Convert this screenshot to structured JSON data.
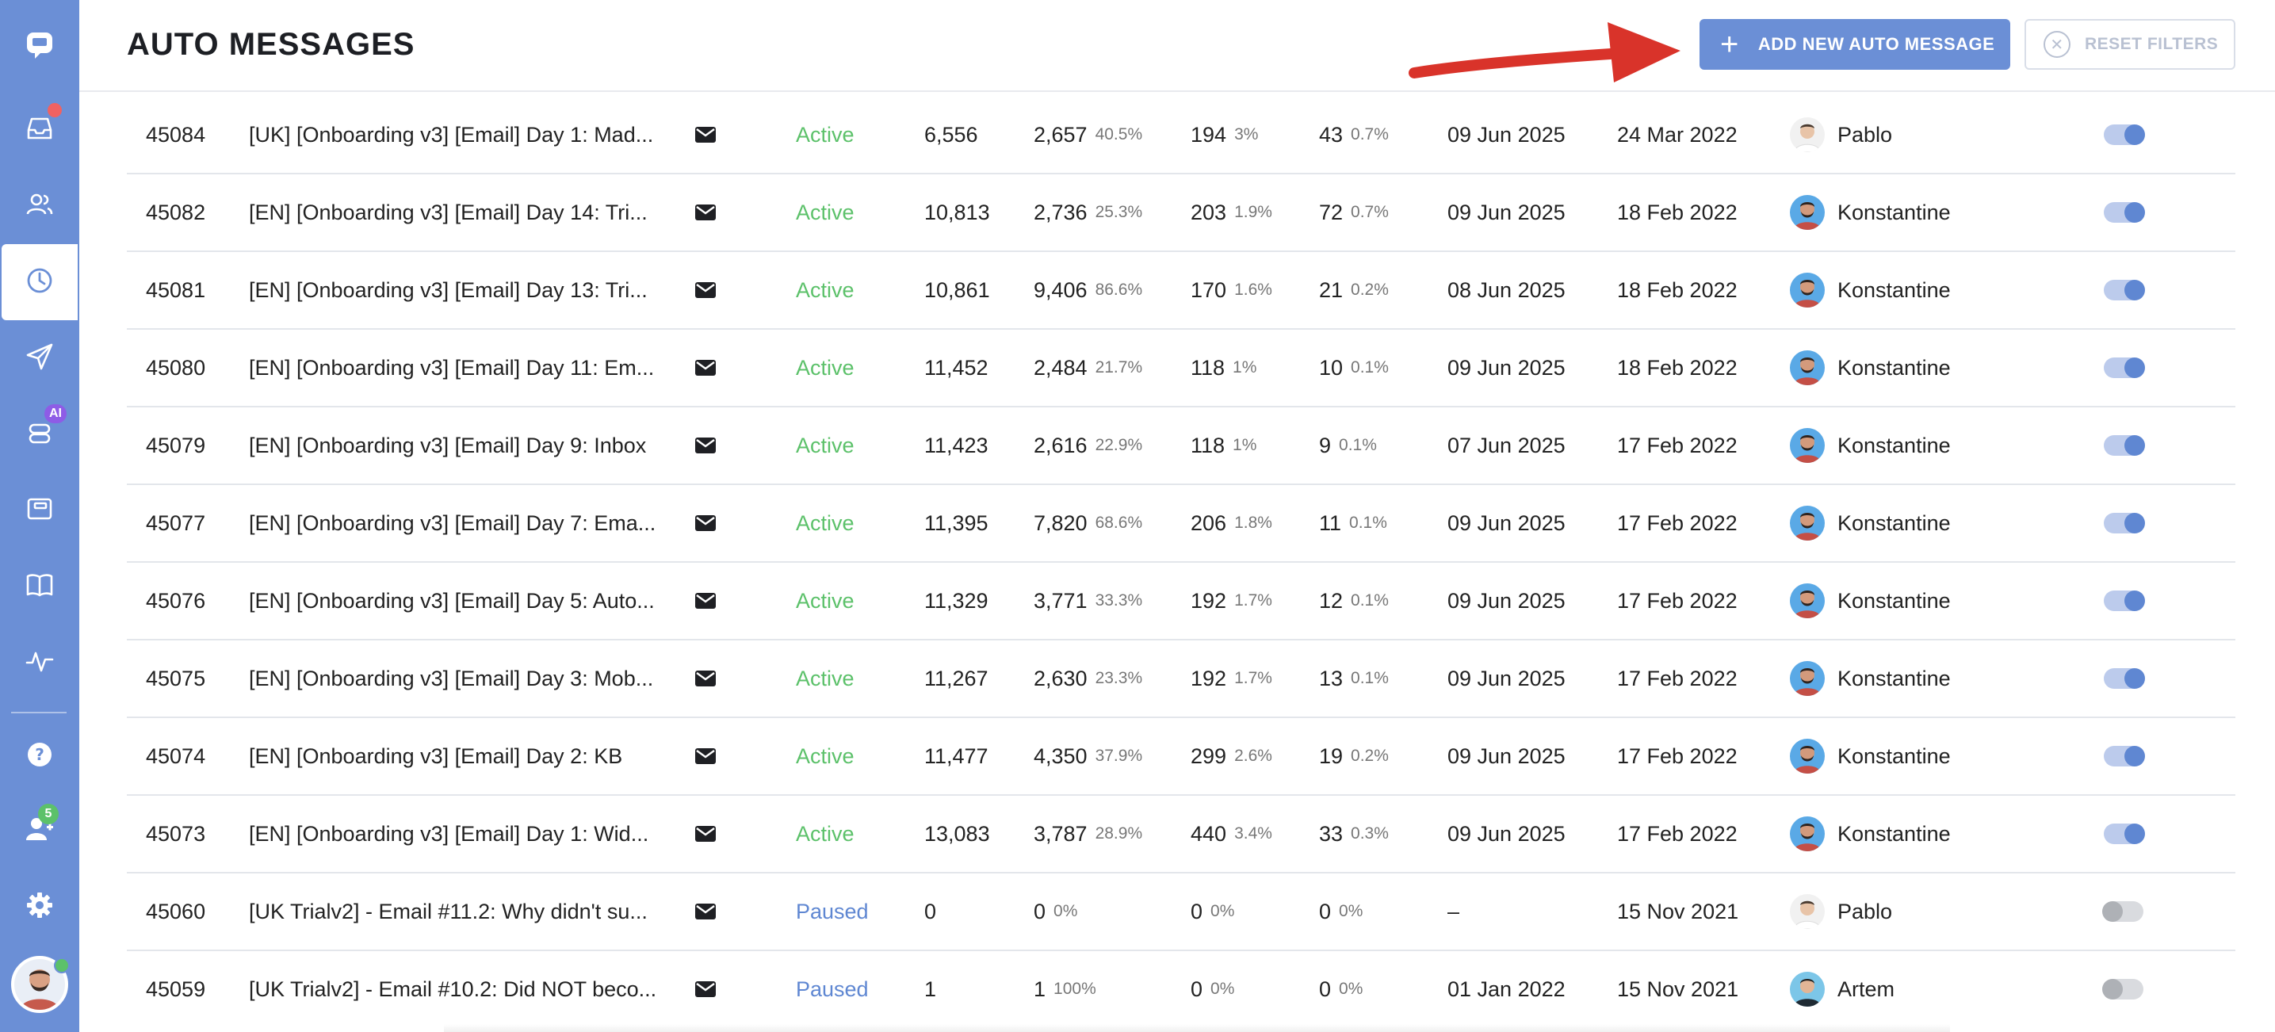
{
  "header": {
    "title": "AUTO MESSAGES",
    "add_button": "ADD NEW AUTO MESSAGE",
    "reset_button": "RESET FILTERS"
  },
  "sidebar": {
    "ai_badge": "AI",
    "leads_badge": "5",
    "items": [
      {
        "icon": "chat-logo-icon"
      },
      {
        "icon": "inbox-icon",
        "has_dot": true
      },
      {
        "icon": "users-icon"
      },
      {
        "icon": "clock-icon",
        "active": true
      },
      {
        "icon": "send-icon"
      },
      {
        "icon": "ai-bot-icon"
      },
      {
        "icon": "wallet-icon"
      },
      {
        "icon": "book-icon"
      },
      {
        "icon": "activity-icon"
      },
      {
        "icon": "help-icon"
      },
      {
        "icon": "leads-icon"
      },
      {
        "icon": "gear-icon"
      }
    ]
  },
  "colors": {
    "sidebar": "#6b8fd6",
    "primary": "#6b8fd6",
    "active_status": "#5cc16a",
    "paused_status": "#5f87d2",
    "annotation_arrow": "#d9332a"
  },
  "rows": [
    {
      "id": "45084",
      "name": "[UK] [Onboarding v3] [Email] Day 1: Mad...",
      "status": "Active",
      "sent": "6,556",
      "opened": "2,657",
      "opened_pct": "40.5%",
      "clicked": "194",
      "clicked_pct": "3%",
      "conv": "43",
      "conv_pct": "0.7%",
      "last": "09 Jun 2025",
      "created": "24 Mar 2022",
      "author": "Pablo",
      "avatar": "pablo",
      "enabled": true
    },
    {
      "id": "45082",
      "name": "[EN] [Onboarding v3] [Email] Day 14: Tri...",
      "status": "Active",
      "sent": "10,813",
      "opened": "2,736",
      "opened_pct": "25.3%",
      "clicked": "203",
      "clicked_pct": "1.9%",
      "conv": "72",
      "conv_pct": "0.7%",
      "last": "09 Jun 2025",
      "created": "18 Feb 2022",
      "author": "Konstantine",
      "avatar": "konst",
      "enabled": true
    },
    {
      "id": "45081",
      "name": "[EN] [Onboarding v3] [Email] Day 13: Tri...",
      "status": "Active",
      "sent": "10,861",
      "opened": "9,406",
      "opened_pct": "86.6%",
      "clicked": "170",
      "clicked_pct": "1.6%",
      "conv": "21",
      "conv_pct": "0.2%",
      "last": "08 Jun 2025",
      "created": "18 Feb 2022",
      "author": "Konstantine",
      "avatar": "konst",
      "enabled": true
    },
    {
      "id": "45080",
      "name": "[EN] [Onboarding v3] [Email] Day 11: Em...",
      "status": "Active",
      "sent": "11,452",
      "opened": "2,484",
      "opened_pct": "21.7%",
      "clicked": "118",
      "clicked_pct": "1%",
      "conv": "10",
      "conv_pct": "0.1%",
      "last": "09 Jun 2025",
      "created": "18 Feb 2022",
      "author": "Konstantine",
      "avatar": "konst",
      "enabled": true
    },
    {
      "id": "45079",
      "name": "[EN] [Onboarding v3] [Email] Day 9: Inbox",
      "status": "Active",
      "sent": "11,423",
      "opened": "2,616",
      "opened_pct": "22.9%",
      "clicked": "118",
      "clicked_pct": "1%",
      "conv": "9",
      "conv_pct": "0.1%",
      "last": "07 Jun 2025",
      "created": "17 Feb 2022",
      "author": "Konstantine",
      "avatar": "konst",
      "enabled": true
    },
    {
      "id": "45077",
      "name": "[EN] [Onboarding v3] [Email] Day 7: Ema...",
      "status": "Active",
      "sent": "11,395",
      "opened": "7,820",
      "opened_pct": "68.6%",
      "clicked": "206",
      "clicked_pct": "1.8%",
      "conv": "11",
      "conv_pct": "0.1%",
      "last": "09 Jun 2025",
      "created": "17 Feb 2022",
      "author": "Konstantine",
      "avatar": "konst",
      "enabled": true
    },
    {
      "id": "45076",
      "name": "[EN] [Onboarding v3] [Email] Day 5: Auto...",
      "status": "Active",
      "sent": "11,329",
      "opened": "3,771",
      "opened_pct": "33.3%",
      "clicked": "192",
      "clicked_pct": "1.7%",
      "conv": "12",
      "conv_pct": "0.1%",
      "last": "09 Jun 2025",
      "created": "17 Feb 2022",
      "author": "Konstantine",
      "avatar": "konst",
      "enabled": true
    },
    {
      "id": "45075",
      "name": "[EN] [Onboarding v3] [Email] Day 3: Mob...",
      "status": "Active",
      "sent": "11,267",
      "opened": "2,630",
      "opened_pct": "23.3%",
      "clicked": "192",
      "clicked_pct": "1.7%",
      "conv": "13",
      "conv_pct": "0.1%",
      "last": "09 Jun 2025",
      "created": "17 Feb 2022",
      "author": "Konstantine",
      "avatar": "konst",
      "enabled": true
    },
    {
      "id": "45074",
      "name": "[EN] [Onboarding v3] [Email] Day 2: KB",
      "status": "Active",
      "sent": "11,477",
      "opened": "4,350",
      "opened_pct": "37.9%",
      "clicked": "299",
      "clicked_pct": "2.6%",
      "conv": "19",
      "conv_pct": "0.2%",
      "last": "09 Jun 2025",
      "created": "17 Feb 2022",
      "author": "Konstantine",
      "avatar": "konst",
      "enabled": true
    },
    {
      "id": "45073",
      "name": "[EN] [Onboarding v3] [Email] Day 1: Wid...",
      "status": "Active",
      "sent": "13,083",
      "opened": "3,787",
      "opened_pct": "28.9%",
      "clicked": "440",
      "clicked_pct": "3.4%",
      "conv": "33",
      "conv_pct": "0.3%",
      "last": "09 Jun 2025",
      "created": "17 Feb 2022",
      "author": "Konstantine",
      "avatar": "konst",
      "enabled": true
    },
    {
      "id": "45060",
      "name": "[UK Trialv2] - Email #11.2: Why didn't su...",
      "status": "Paused",
      "sent": "0",
      "opened": "0",
      "opened_pct": "0%",
      "clicked": "0",
      "clicked_pct": "0%",
      "conv": "0",
      "conv_pct": "0%",
      "last": "–",
      "created": "15 Nov 2021",
      "author": "Pablo",
      "avatar": "pablo",
      "enabled": false
    },
    {
      "id": "45059",
      "name": "[UK Trialv2] - Email #10.2: Did NOT beco...",
      "status": "Paused",
      "sent": "1",
      "opened": "1",
      "opened_pct": "100%",
      "clicked": "0",
      "clicked_pct": "0%",
      "conv": "0",
      "conv_pct": "0%",
      "last": "01 Jan 2022",
      "created": "15 Nov 2021",
      "author": "Artem",
      "avatar": "artem",
      "enabled": false
    }
  ]
}
